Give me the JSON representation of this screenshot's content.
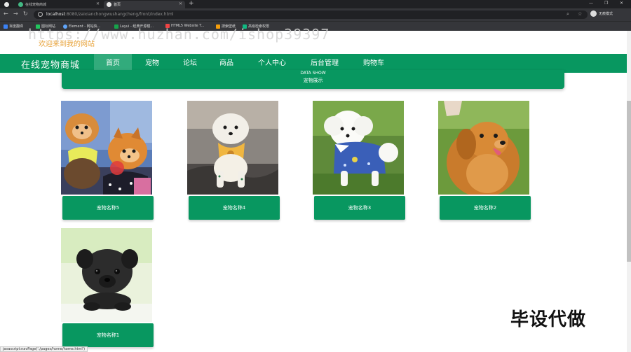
{
  "browser": {
    "tabs": [
      {
        "label": "在线宠物商城"
      },
      {
        "label": "首页"
      }
    ],
    "address": {
      "host": "localhost",
      "rest": ":8080/zaixianchongwushangcheng/front/index.html"
    },
    "profile_label": "无痕模式",
    "bookmarks": [
      {
        "label": "百度翻译",
        "color": "#3b82f6"
      },
      {
        "label": "图标网站",
        "color": "#22c55e"
      },
      {
        "label": "Element - 网站快...",
        "color": "#60a5fa"
      },
      {
        "label": "Layui - 经典开源模...",
        "color": "#16a34a"
      },
      {
        "label": "HTML5 Website T...",
        "color": "#ef4444"
      },
      {
        "label": "搜索壁纸",
        "color": "#f59e0b"
      },
      {
        "label": "高级检索权限",
        "color": "#10b981"
      }
    ]
  },
  "site": {
    "welcome": "欢迎来到我的网站",
    "brand": "在线宠物商城",
    "nav": [
      {
        "label": "首页",
        "active": true
      },
      {
        "label": "宠物"
      },
      {
        "label": "论坛"
      },
      {
        "label": "商品"
      },
      {
        "label": "个人中心"
      },
      {
        "label": "后台管理"
      },
      {
        "label": "购物车"
      }
    ],
    "section_en": "DATA SHOW",
    "section_cn": "宠物展示",
    "pets": [
      {
        "name": "宠物名称5",
        "image": "pomeranians"
      },
      {
        "name": "宠物名称4",
        "image": "white-puppy-bib"
      },
      {
        "name": "宠物名称3",
        "image": "bichon-blue-shirt"
      },
      {
        "name": "宠物名称2",
        "image": "golden-retriever"
      },
      {
        "name": "宠物名称1",
        "image": "black-pug"
      }
    ]
  },
  "overlay": {
    "watermark": "https://www.huzhan.com/ishop39397",
    "corner_text": "毕设代做",
    "status_url": "javascript:navPage('./pages/home/home.html')"
  },
  "colors": {
    "primary": "#089760",
    "nav_active": "#32ab7c",
    "welcome": "#e8a33a"
  }
}
